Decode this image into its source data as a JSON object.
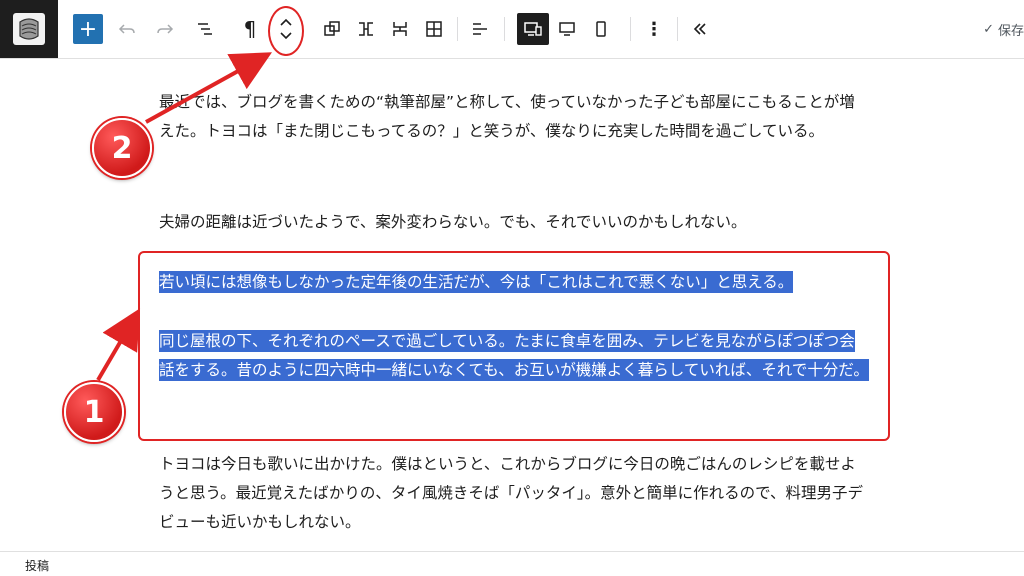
{
  "toolbar": {
    "add_icon": "plus-icon",
    "undo_icon": "undo-icon",
    "redo_icon": "redo-icon",
    "list_view_icon": "list-view-icon",
    "paragraph_icon": "pilcrow-icon",
    "move_icon": "up-down-chevron-icon",
    "block_type_icons": [
      "group-icon",
      "row-icon",
      "stack-icon",
      "grid-icon"
    ],
    "align_icon": "align-left-icon",
    "preview_icons": [
      "desktop-tablet-icon",
      "desktop-icon",
      "mobile-icon"
    ],
    "options_icon": "more-vertical-icon",
    "collapse_icon": "double-chevron-left-icon",
    "saved_label": "保存"
  },
  "content": {
    "p1": "最近では、ブログを書くための“執筆部屋”と称して、使っていなかった子ども部屋にこもることが増えた。トヨコは「また閉じこもってるの？」と笑うが、僕なりに充実した時間を過ごしている。",
    "p2": "夫婦の距離は近づいたようで、案外変わらない。でも、それでいいのかもしれない。",
    "sel1": "若い頃には想像もしなかった定年後の生活だが、今は「これはこれで悪くない」と思える。",
    "sel2": "同じ屋根の下、それぞれのペースで過ごしている。たまに食卓を囲み、テレビを見ながらぽつぽつ会話をする。昔のように四六時中一緒にいなくても、お互いが機嫌よく暮らしていれば、それで十分だ。",
    "p3": "トヨコは今日も歌いに出かけた。僕はというと、これからブログに今日の晩ごはんのレシピを載せようと思う。最近覚えたばかりの、タイ風焼きそば「パッタイ」。意外と簡単に作れるので、料理男子デビューも近いかもしれない。"
  },
  "annotations": {
    "num1": "1",
    "num2": "2",
    "color": "#e02424"
  },
  "status": {
    "breadcrumb": "投稿"
  },
  "colors": {
    "accent": "#2271b1",
    "selection": "#3a6bd1"
  }
}
